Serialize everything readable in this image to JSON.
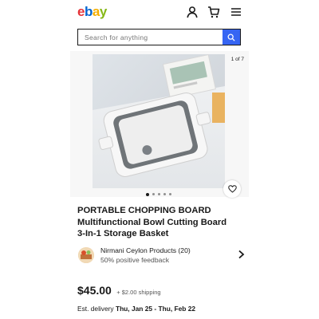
{
  "brand": {
    "logo_letters": [
      "e",
      "b",
      "a",
      "y"
    ]
  },
  "header": {
    "icons": [
      "user-icon",
      "cart-icon",
      "menu-icon"
    ]
  },
  "search": {
    "placeholder": "Search for anything",
    "button_icon": "search-icon"
  },
  "gallery": {
    "counter": "1 of 7",
    "image_count": 5,
    "active_index": 0
  },
  "listing": {
    "title_lines": [
      "PORTABLE CHOPPING BOARD",
      "Multifunctional Bowl Cutting Board",
      "3-In-1 Storage Basket"
    ]
  },
  "seller": {
    "name": "Nirmani Ceylon Products (20)",
    "feedback": "50% positive feedback"
  },
  "price": {
    "amount": "$45.00",
    "shipping": "+ $2.00 shipping"
  },
  "delivery": {
    "label": "Est. delivery",
    "dates": "Thu, Jan 25 - Thu, Feb 22"
  },
  "colors": {
    "accent": "#3665f3",
    "text": "#191919",
    "muted": "#555555"
  }
}
